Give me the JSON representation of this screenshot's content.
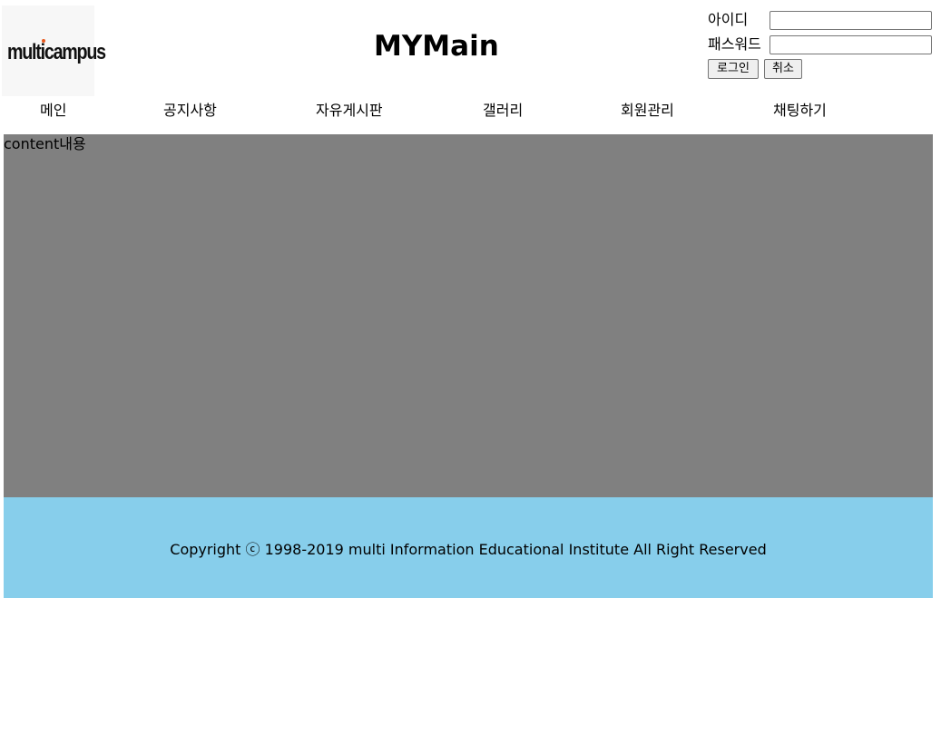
{
  "header": {
    "logo_text": "multicampus",
    "title": "MYMain"
  },
  "login": {
    "id_label": "아이디",
    "password_label": "패스워드",
    "id_value": "",
    "password_value": "",
    "login_button": "로그인",
    "cancel_button": "취소"
  },
  "nav": {
    "items": [
      {
        "label": "메인"
      },
      {
        "label": "공지사항"
      },
      {
        "label": "자유게시판"
      },
      {
        "label": "갤러리"
      },
      {
        "label": "회원관리"
      },
      {
        "label": "채팅하기"
      }
    ]
  },
  "content": {
    "text": "content내용",
    "background": "#808080"
  },
  "footer": {
    "text": "Copyright ⓒ 1998-2019 multi Information Educational Institute All Right Reserved",
    "background": "#87ceeb"
  }
}
